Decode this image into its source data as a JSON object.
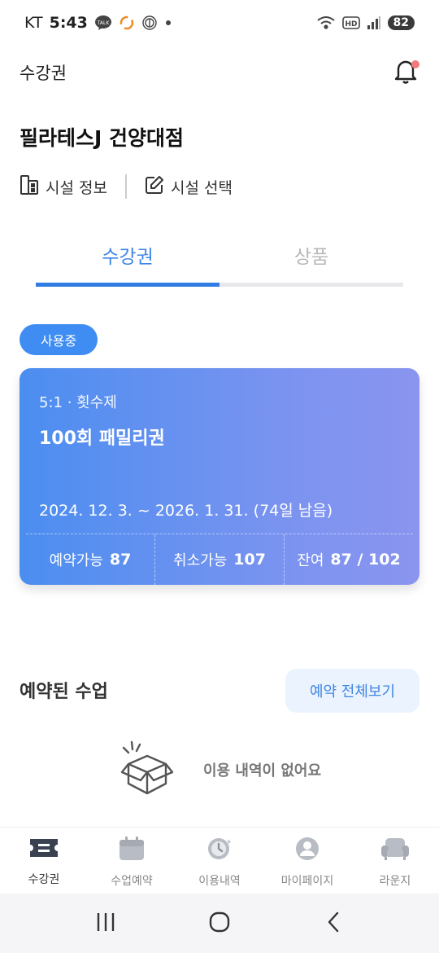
{
  "status_bar": {
    "carrier": "KT",
    "time": "5:43",
    "battery": "82",
    "hd_label": "HD",
    "talk_label": "TALK"
  },
  "header": {
    "title": "수강권"
  },
  "facility": {
    "name": "필라테스J 건양대점",
    "info_label": "시설 정보",
    "select_label": "시설 선택"
  },
  "tabs": [
    {
      "label": "수강권",
      "active": true
    },
    {
      "label": "상품",
      "active": false
    }
  ],
  "pass": {
    "status": "사용중",
    "type": "5:1 · 횟수제",
    "name": "100회 패밀리권",
    "period": "2024. 12. 3. ~ 2026. 1. 31. (74일 남음)",
    "stats": [
      {
        "label": "예약가능",
        "value": "87"
      },
      {
        "label": "취소가능",
        "value": "107"
      },
      {
        "label": "잔여",
        "value": "87 / 102"
      }
    ]
  },
  "reservations": {
    "title": "예약된 수업",
    "view_all_label": "예약 전체보기",
    "empty_text": "이용 내역이 없어요"
  },
  "bottom_nav": [
    {
      "label": "수강권",
      "icon": "ticket-icon",
      "active": true
    },
    {
      "label": "수업예약",
      "icon": "calendar-icon",
      "active": false
    },
    {
      "label": "이용내역",
      "icon": "history-icon",
      "active": false
    },
    {
      "label": "마이페이지",
      "icon": "person-icon",
      "active": false
    },
    {
      "label": "라운지",
      "icon": "sofa-icon",
      "active": false
    }
  ],
  "colors": {
    "accent": "#3f8cf2",
    "tab_active": "#3d86e8",
    "card_gradient_start": "#4b8ef0",
    "card_gradient_end": "#8a95ef",
    "notification_dot": "#f47a7a"
  }
}
